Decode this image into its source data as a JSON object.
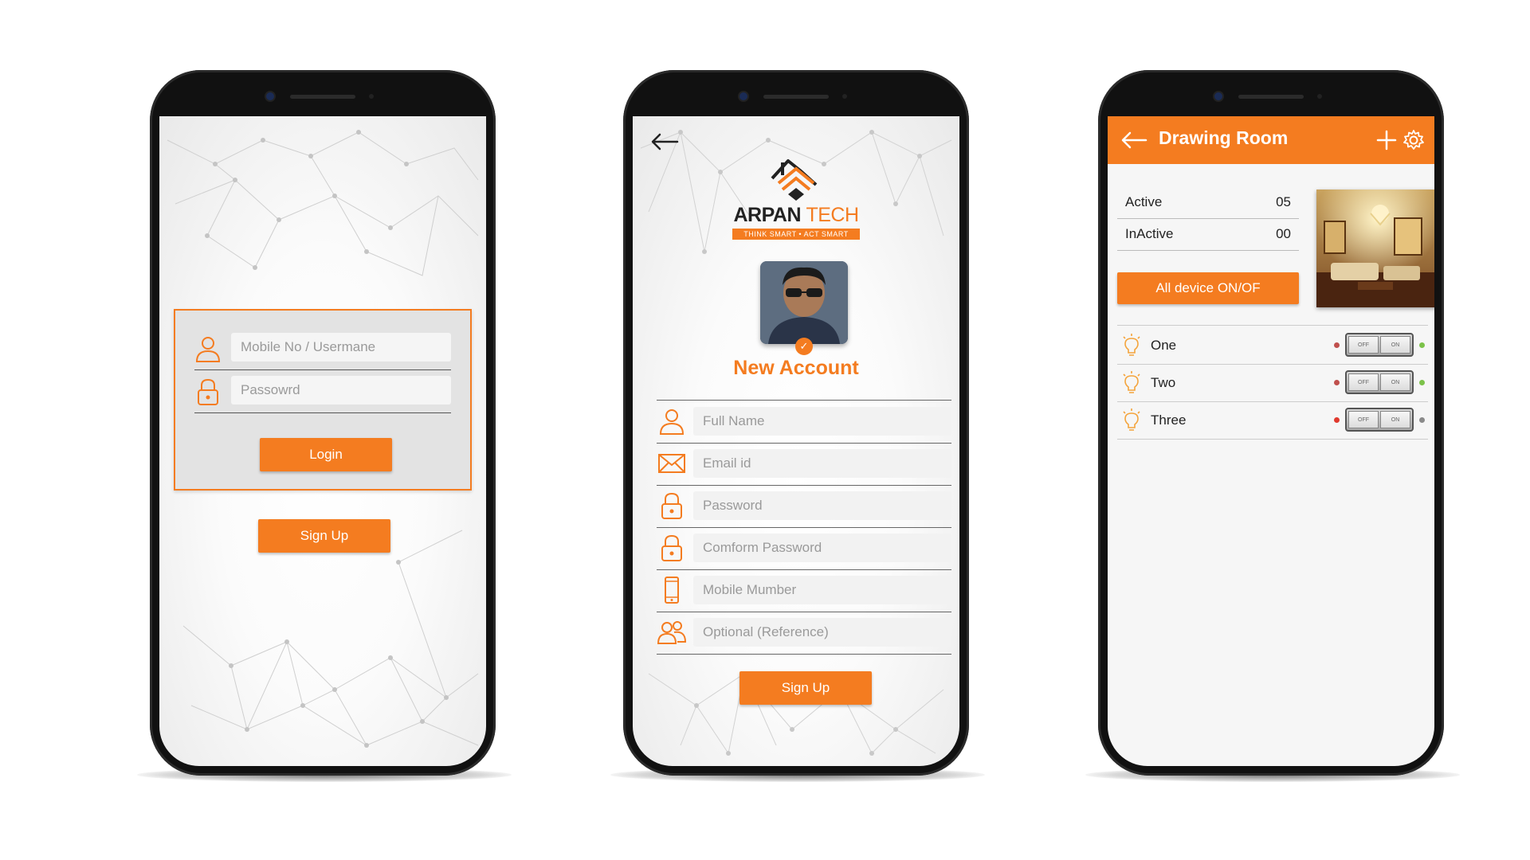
{
  "colors": {
    "accent": "#f47c20",
    "phone_body": "#111111",
    "screen_bg": "#f4f4f4"
  },
  "login_screen": {
    "username_placeholder": "Mobile No / Usermane",
    "password_placeholder": "Passowrd",
    "login_label": "Login",
    "signup_label": "Sign Up",
    "icons": [
      "user-icon",
      "lock-icon"
    ]
  },
  "signup_screen": {
    "brand": {
      "name_part1": "ARPAN",
      "name_part2": "TECH",
      "tagline": "THINK SMART • ACT SMART"
    },
    "title": "New Account",
    "fields": [
      {
        "icon": "user-icon",
        "placeholder": "Full Name"
      },
      {
        "icon": "mail-icon",
        "placeholder": "Email id"
      },
      {
        "icon": "lock-icon",
        "placeholder": "Password"
      },
      {
        "icon": "lock-icon",
        "placeholder": "Comform Password"
      },
      {
        "icon": "phone-icon",
        "placeholder": "Mobile Mumber"
      },
      {
        "icon": "users-icon",
        "placeholder": "Optional (Reference)"
      }
    ],
    "signup_label": "Sign Up"
  },
  "room_screen": {
    "title": "Drawing Room",
    "stats": [
      {
        "label": "Active",
        "value": "05"
      },
      {
        "label": "InActive",
        "value": "00"
      }
    ],
    "all_devices_label": "All device ON/OF",
    "devices": [
      {
        "name": "One",
        "state": "on",
        "led_left": "#c0504d",
        "led_right": "#7cc24a"
      },
      {
        "name": "Two",
        "state": "on",
        "led_left": "#c0504d",
        "led_right": "#7cc24a"
      },
      {
        "name": "Three",
        "state": "off",
        "led_left": "#e03a2e",
        "led_right": "#8a8a8a"
      }
    ],
    "toggle_off_text": "OFF",
    "toggle_on_text": "ON"
  }
}
